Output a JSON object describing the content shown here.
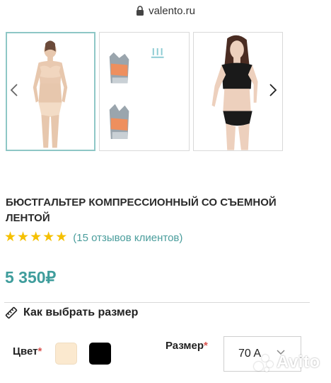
{
  "browser": {
    "url": "valento.ru"
  },
  "gallery": {
    "thumbnails": [
      {
        "label": "model-front-beige"
      },
      {
        "label": "bra-detail"
      },
      {
        "label": "model-black"
      }
    ]
  },
  "product": {
    "title": "БЮСТГАЛЬТЕР КОМПРЕССИОННЫЙ СО СЪЕМНОЙ ЛЕНТОЙ",
    "rating": 5,
    "reviews": "(15 отзывов клиентов)",
    "price": "5 350₽"
  },
  "size_guide": {
    "label": "Как выбрать размер"
  },
  "options": {
    "color_label": "Цвет",
    "required_mark": "*",
    "colors": [
      "#fbe9cf",
      "#000000"
    ],
    "size_label": "Размер",
    "size_value": "70 A"
  },
  "watermark": {
    "text": "Avito"
  },
  "colors": {
    "accent": "#4a9d9c",
    "star": "#f5c000",
    "required": "#d9534f"
  }
}
